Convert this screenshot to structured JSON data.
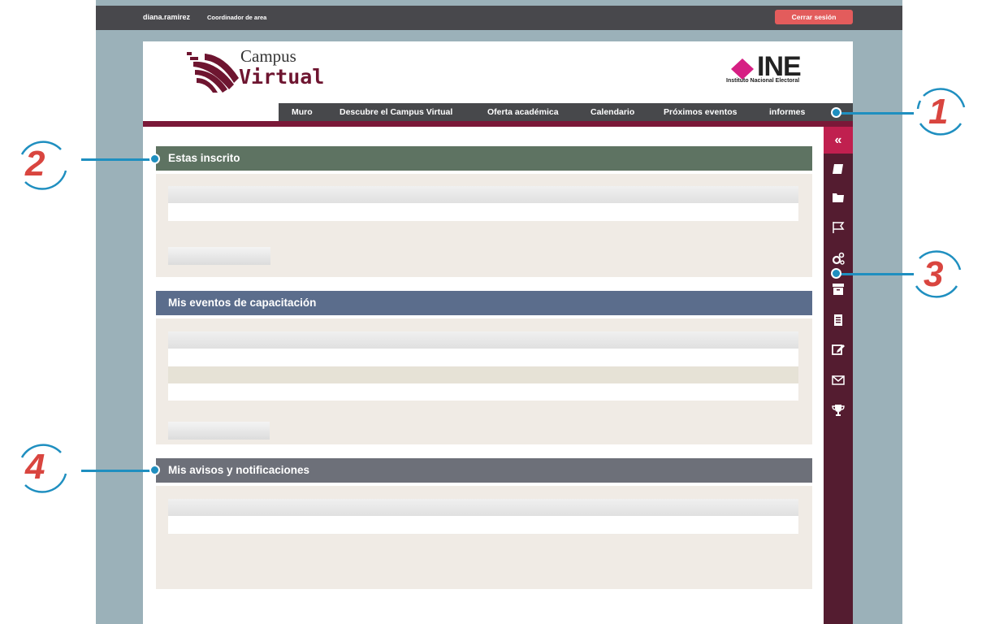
{
  "topbar": {
    "user_name": "diana.ramirez",
    "user_role": "Coordinador de area",
    "logout_label": "Cerrar sesión"
  },
  "brand": {
    "campus_line1": "Campus",
    "campus_line2": "Virtual",
    "ine_title": "INE",
    "ine_subtitle": "Instituto Nacional Electoral"
  },
  "nav": {
    "items": [
      {
        "label": "Muro"
      },
      {
        "label": "Descubre el Campus Virtual"
      },
      {
        "label": "Oferta académica"
      },
      {
        "label": "Calendario"
      },
      {
        "label": "Próximos eventos"
      },
      {
        "label": "informes"
      }
    ]
  },
  "dock": {
    "collapse_label": "«",
    "icons": [
      "book-icon",
      "folder-icon",
      "flag-icon",
      "gears-icon",
      "archive-icon",
      "document-icon",
      "edit-icon",
      "mail-icon",
      "trophy-icon"
    ]
  },
  "panels": {
    "enrolled": {
      "title": "Estas inscrito"
    },
    "events": {
      "title": "Mis eventos de capacitación"
    },
    "notices": {
      "title": "Mis avisos y notificaciones"
    }
  },
  "callouts": [
    "1",
    "2",
    "3",
    "4"
  ],
  "colors": {
    "topbar": "#48484c",
    "frame": "#9bb1b9",
    "accent": "#7a1838",
    "dock": "#541c30",
    "dock_active": "#c0204f",
    "enrolled_header": "#5e7362",
    "events_header": "#5b6d8c",
    "notices_header": "#6d7079",
    "callout_number": "#d9453f",
    "callout_line": "#1f8fc0"
  }
}
